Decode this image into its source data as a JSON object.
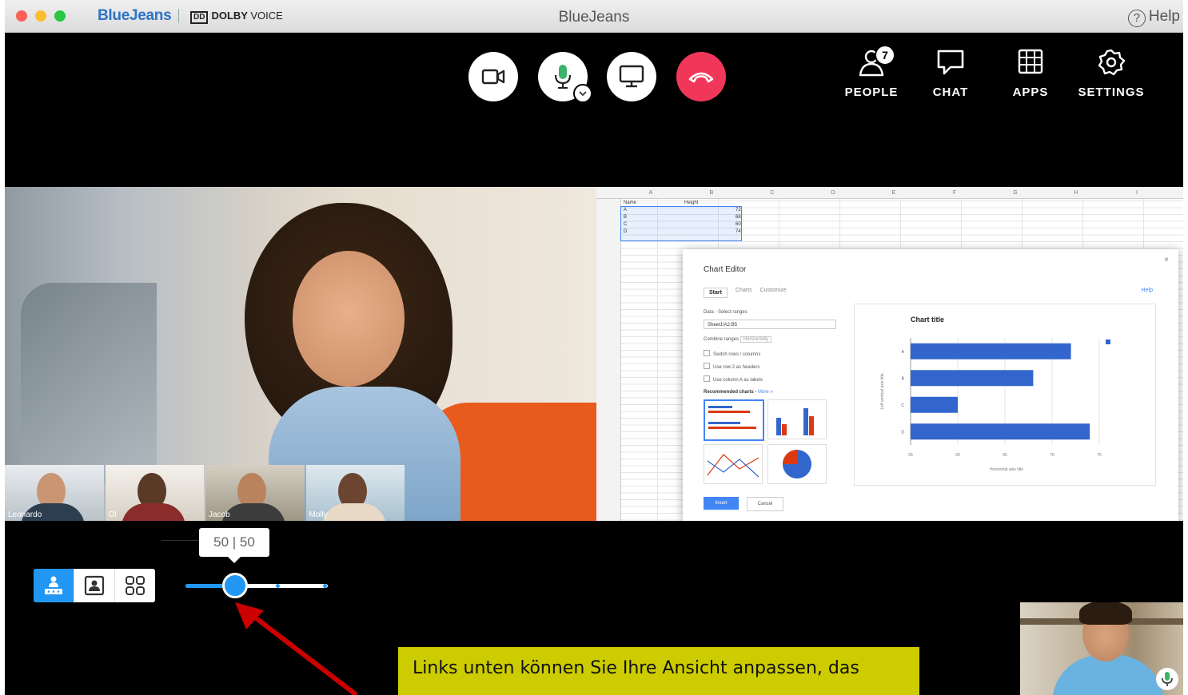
{
  "titlebar": {
    "brand": "BlueJeans",
    "partner": "DOLBY",
    "partner_suffix": "VOICE",
    "window_title": "BlueJeans",
    "help_label": "Help"
  },
  "top_nav": [
    {
      "label": "PEOPLE",
      "badge": "7",
      "icon": "people-icon"
    },
    {
      "label": "CHAT",
      "icon": "chat-icon"
    },
    {
      "label": "APPS",
      "icon": "apps-grid-icon"
    },
    {
      "label": "SETTINGS",
      "icon": "gear-icon"
    }
  ],
  "call_controls": [
    {
      "name": "video-toggle-button",
      "icon": "video-camera-icon"
    },
    {
      "name": "mic-toggle-button",
      "icon": "microphone-icon"
    },
    {
      "name": "screen-share-button",
      "icon": "monitor-icon"
    },
    {
      "name": "hang-up-button",
      "icon": "phone-hangup-icon"
    }
  ],
  "participants": [
    {
      "name": "Leonardo"
    },
    {
      "name": "Ol"
    },
    {
      "name": "Jacob"
    },
    {
      "name": "Molly"
    }
  ],
  "spreadsheet": {
    "columns": [
      "A",
      "B",
      "C",
      "D",
      "E",
      "F",
      "G",
      "H",
      "I"
    ],
    "header_row": [
      "Name",
      "Height"
    ],
    "rows": [
      {
        "name": "A",
        "height": "72"
      },
      {
        "name": "B",
        "height": "68"
      },
      {
        "name": "C",
        "height": "60"
      },
      {
        "name": "D",
        "height": "74"
      }
    ]
  },
  "chart_editor": {
    "title": "Chart Editor",
    "close": "×",
    "tabs": [
      "Start",
      "Charts",
      "Customize"
    ],
    "help": "Help",
    "data_label": "Data - Select ranges",
    "data_range": "Sheet1!A2:B5",
    "combine_label": "Combine ranges",
    "combine_value": "Horizontally",
    "options": [
      "Switch rows / columns",
      "Use row 2 as headers",
      "Use column A as labels"
    ],
    "recommended_label": "Recommended charts -",
    "more_link": "More »",
    "insert_label": "Insert",
    "cancel_label": "Cancel",
    "preview": {
      "title": "Chart title",
      "ylabel": "Left vertical axis title",
      "xlabel": "Horizontal axis title"
    }
  },
  "chart_data": {
    "type": "bar",
    "orientation": "horizontal",
    "title": "Chart title",
    "xlabel": "Horizontal axis title",
    "ylabel": "Left vertical axis title",
    "categories": [
      "A",
      "B",
      "C",
      "D"
    ],
    "values": [
      72,
      68,
      60,
      74
    ],
    "xlim": [
      55,
      75
    ],
    "x_ticks": [
      "55",
      "60",
      "65",
      "70",
      "75"
    ],
    "grid": true,
    "bar_color": "#3366cc"
  },
  "layout_controls": {
    "options": [
      {
        "name": "layout-speaker-button",
        "icon": "presenter-icon",
        "active": true
      },
      {
        "name": "layout-person-button",
        "icon": "person-card-icon",
        "active": false
      },
      {
        "name": "layout-gallery-button",
        "icon": "grid-icon",
        "active": false
      }
    ],
    "slider_label": "50 | 50",
    "slider_value": 0.35
  },
  "annotation": {
    "text": "Links unten können Sie Ihre Ansicht anpassen, das"
  },
  "colors": {
    "accent": "#2196f3",
    "hangup": "#f0375a",
    "annotation_bg": "#cccc00",
    "arrow": "#cc0000"
  }
}
